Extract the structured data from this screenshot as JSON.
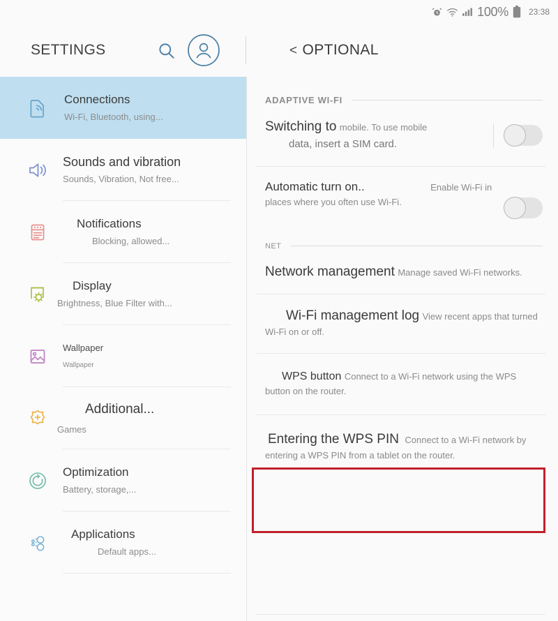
{
  "statusbar": {
    "icons": [
      "alarm-icon",
      "wifi-icon",
      "signal-icon",
      "battery-icon"
    ],
    "battery_percent": "100%",
    "clock": "23:38"
  },
  "header": {
    "app_title": "SETTINGS",
    "search_icon": "search-icon",
    "account_icon": "account-icon",
    "page_back_chevron": "<",
    "page_title": "OPTIONAL"
  },
  "sidebar": {
    "items": [
      {
        "title": "Connections",
        "subtitle": "Wi-Fi, Bluetooth, using...",
        "icon": "connections-icon",
        "color": "#6aa3c8",
        "selected": true
      },
      {
        "title": "Sounds and vibration",
        "subtitle": "Sounds, Vibration, Not free...",
        "icon": "sound-icon",
        "color": "#7b8fd0",
        "selected": false
      },
      {
        "title": "Notifications",
        "subtitle": "Blocking, allowed...",
        "icon": "notifications-icon",
        "color": "#e8908e",
        "selected": false
      },
      {
        "title": "Display",
        "subtitle": "Brightness, Blue Filter with...",
        "icon": "display-icon",
        "color": "#b0bf4a",
        "selected": false
      },
      {
        "title": "Wallpaper",
        "subtitle": "Wallpaper",
        "icon": "wallpaper-icon",
        "color": "#c07fc4",
        "selected": false
      },
      {
        "title": "Additional...",
        "subtitle": "Games",
        "icon": "additional-icon",
        "color": "#edb44a",
        "selected": false
      },
      {
        "title": "Optimization",
        "subtitle": "Battery, storage,...",
        "icon": "optimization-icon",
        "color": "#6fb8a8",
        "selected": false
      },
      {
        "title": "Applications",
        "subtitle": "Default apps...",
        "icon": "applications-icon",
        "color": "#7fb6d6",
        "selected": false
      }
    ]
  },
  "content": {
    "sections": [
      {
        "label": "ADAPTIVE WI-FI"
      },
      {
        "label": "NET"
      }
    ],
    "rows": {
      "switching": {
        "title": "Switching to",
        "subtitle_line1": "mobile. To use mobile",
        "subtitle_line2": "data, insert a SIM card.",
        "toggle_state": "off"
      },
      "automatic": {
        "title": "Automatic turn on..",
        "subtitle": "Enable Wi-Fi in places where you often use Wi-Fi.",
        "toggle_state": "off"
      },
      "network_management": {
        "title": "Network management",
        "subtitle": "Manage saved Wi-Fi networks."
      },
      "wifi_log": {
        "title": "Wi-Fi management log",
        "subtitle": "View recent apps that turned Wi-Fi on or off."
      },
      "wps_button": {
        "title": "WPS button",
        "subtitle": "Connect to a Wi-Fi network using the WPS button on the router.",
        "highlighted": true,
        "highlight_color": "#c0202a"
      },
      "wps_pin": {
        "title": "Entering the WPS PIN",
        "subtitle": "Connect to a Wi-Fi network by entering a WPS PIN from a tablet on the router."
      }
    }
  },
  "colors": {
    "selected_row_bg": "#bfdff0",
    "accent_blue": "#4b7fa5",
    "highlight_red": "#c0202a",
    "page_bg": "#fafafa"
  }
}
